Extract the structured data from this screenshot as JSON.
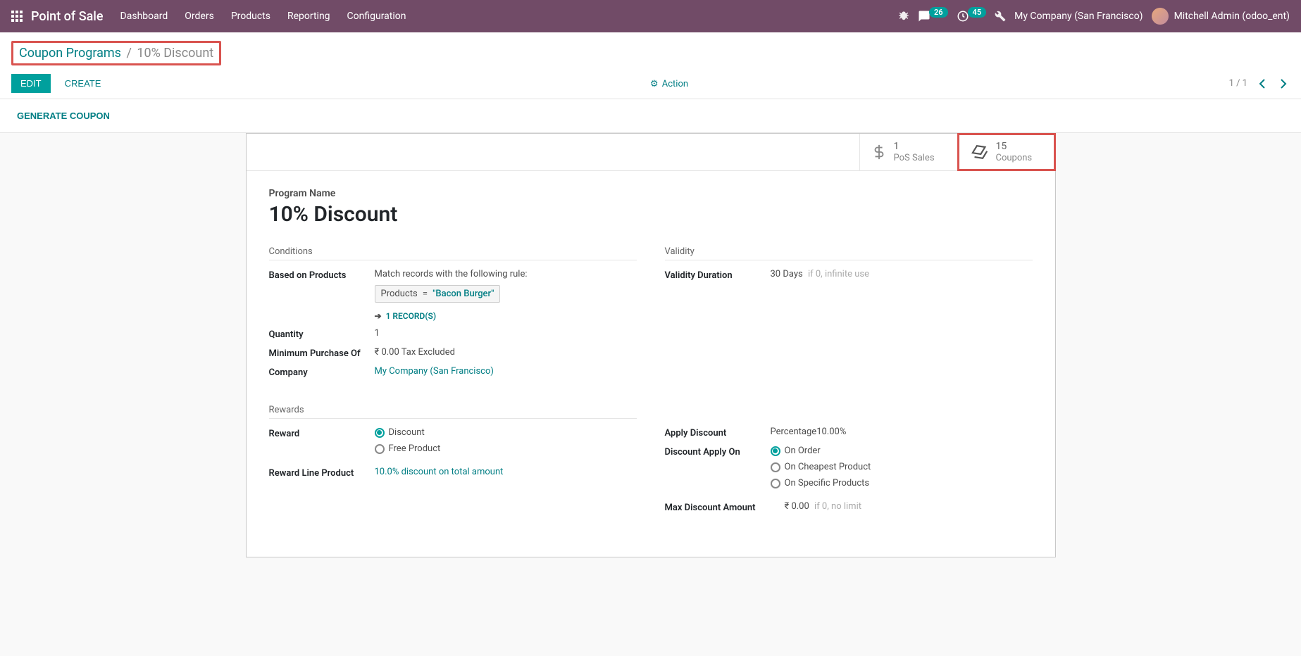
{
  "navbar": {
    "app_name": "Point of Sale",
    "menu": [
      "Dashboard",
      "Orders",
      "Products",
      "Reporting",
      "Configuration"
    ],
    "messages_badge": "26",
    "activities_badge": "45",
    "company": "My Company (San Francisco)",
    "user_name": "Mitchell Admin (odoo_ent)"
  },
  "breadcrumb": {
    "parent": "Coupon Programs",
    "current": "10% Discount"
  },
  "controls": {
    "edit": "EDIT",
    "create": "CREATE",
    "action": "Action",
    "pager_text": "1 / 1"
  },
  "statusbar": {
    "generate": "GENERATE COUPON"
  },
  "stat_buttons": {
    "pos_sales": {
      "value": "1",
      "label": "PoS Sales"
    },
    "coupons": {
      "value": "15",
      "label": "Coupons"
    }
  },
  "title": {
    "label": "Program Name",
    "value": "10% Discount"
  },
  "sections": {
    "conditions": "Conditions",
    "validity": "Validity",
    "rewards": "Rewards"
  },
  "fields": {
    "based_on_products": {
      "label": "Based on Products",
      "desc": "Match records with the following rule:",
      "domain_field": "Products",
      "domain_op": "=",
      "domain_value": "\"Bacon Burger\"",
      "records": "1 RECORD(S)"
    },
    "quantity": {
      "label": "Quantity",
      "value": "1"
    },
    "min_purchase": {
      "label": "Minimum Purchase Of",
      "value": "₹ 0.00  Tax Excluded"
    },
    "company": {
      "label": "Company",
      "value": "My Company (San Francisco)"
    },
    "validity_duration": {
      "label": "Validity Duration",
      "value": "30 Days",
      "hint": "if 0, infinite use"
    },
    "reward": {
      "label": "Reward",
      "options": [
        "Discount",
        "Free Product"
      ],
      "selected": 0
    },
    "reward_line_product": {
      "label": "Reward Line Product",
      "value": "10.0% discount on total amount"
    },
    "apply_discount": {
      "label": "Apply Discount",
      "value": "Percentage10.00%"
    },
    "discount_apply_on": {
      "label": "Discount Apply On",
      "options": [
        "On Order",
        "On Cheapest Product",
        "On Specific Products"
      ],
      "selected": 0
    },
    "max_discount": {
      "label": "Max Discount Amount",
      "value": "₹ 0.00",
      "hint": "if 0, no limit"
    }
  }
}
